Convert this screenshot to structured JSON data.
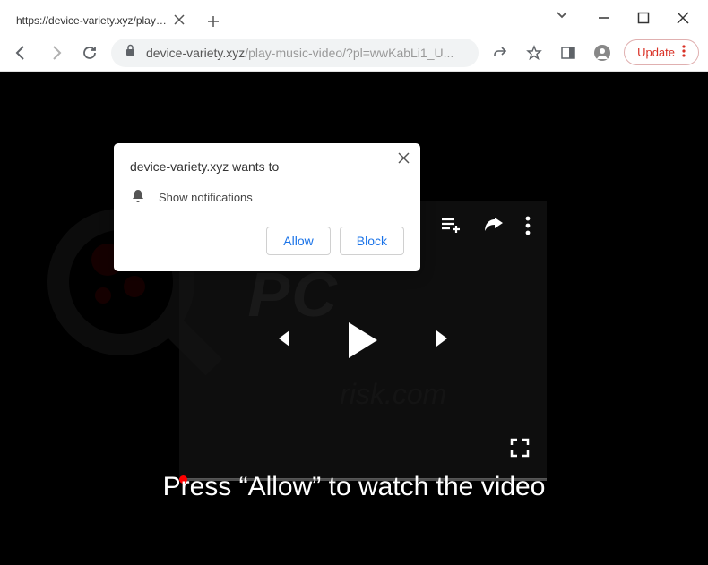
{
  "tab": {
    "title": "https://device-variety.xyz/play-m"
  },
  "url": {
    "host": "device-variety.xyz",
    "path": "/play-music-video/?pl=wwKabLi1_U..."
  },
  "update": {
    "label": "Update"
  },
  "permission": {
    "title": "device-variety.xyz wants to",
    "description": "Show notifications",
    "allow": "Allow",
    "block": "Block"
  },
  "cta": {
    "text": "Press “Allow” to watch the video"
  },
  "watermark": {
    "brand": "PC",
    "sub": "risk.com"
  }
}
